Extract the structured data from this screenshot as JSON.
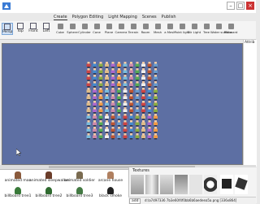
{
  "menu": {
    "tabs": [
      "Create",
      "Polygon Editing",
      "Light Mapping",
      "Scenes",
      "Publish"
    ]
  },
  "window": {
    "minimize": "–",
    "maximize": "□",
    "close": "×"
  },
  "views": [
    "Persp",
    "Top",
    "Front",
    "Left"
  ],
  "tools": [
    "Cube",
    "Sphere",
    "Cylinder",
    "Cone",
    "Plane",
    "Camera",
    "Terrain",
    "Room",
    "Mesh",
    "a Mesh",
    "Point light",
    "Dir Light",
    "Tree",
    "Water surface",
    "Billboard"
  ],
  "panel": {
    "title": "Attrib"
  },
  "assets": {
    "row1": [
      "animated man",
      "animated sleepwalker",
      "animated soldier",
      "arcane house"
    ],
    "row2": [
      "billboard tree1",
      "billboard tree2",
      "billboard tree3",
      "black smoke"
    ]
  },
  "textures": {
    "label": "Textures",
    "add_button": "add",
    "path": "d:\\a7497336 7b3e60f4f0bb6b6aedeea5a.png [336x864]"
  },
  "colors": {
    "viewport_bg": "#5d6fa3",
    "active_view": "#cfe0f5"
  }
}
